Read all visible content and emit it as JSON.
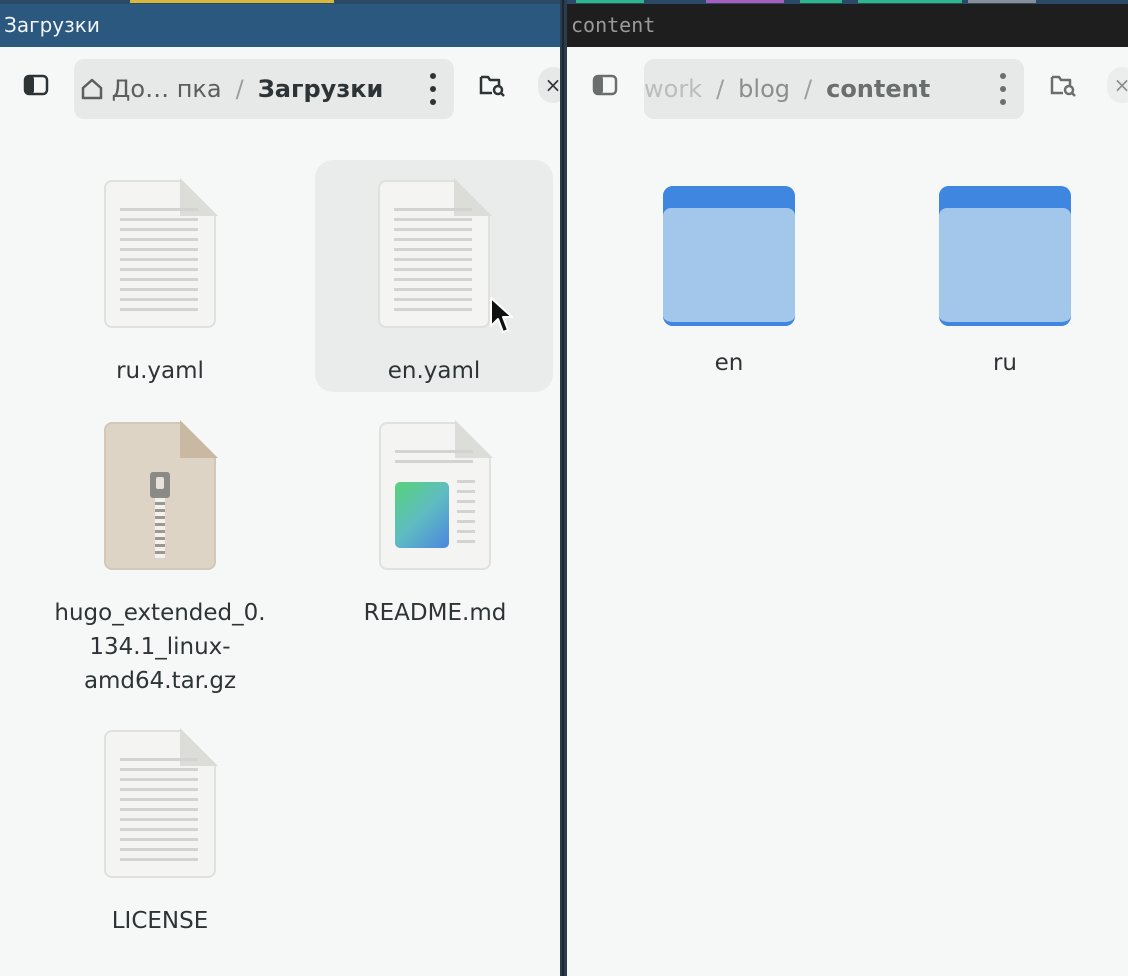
{
  "left_window": {
    "title": "Загрузки",
    "breadcrumb": {
      "home": "До… пка",
      "separator": "/",
      "current": "Загрузки"
    },
    "files": [
      {
        "name": "ru.yaml",
        "type": "text"
      },
      {
        "name": "en.yaml",
        "type": "text",
        "selected": true
      },
      {
        "name": "hugo_extended_0.134.1_linux-amd64.tar.gz",
        "type": "archive"
      },
      {
        "name": "README.md",
        "type": "markdown"
      },
      {
        "name": "LICENSE",
        "type": "text"
      }
    ]
  },
  "right_window": {
    "title": "content",
    "breadcrumb": {
      "seg1": "work",
      "seg2": "blog",
      "current": "content",
      "separator": "/"
    },
    "folders": [
      {
        "name": "en"
      },
      {
        "name": "ru"
      }
    ]
  },
  "icons": {
    "sidebar_toggle": "sidebar-toggle-icon",
    "home": "home-icon",
    "menu": "kebab-menu-icon",
    "search_folder": "folder-search-icon",
    "close": "close-icon"
  },
  "colors": {
    "left_titlebar": "#2b587e",
    "right_titlebar": "#1e1e1e",
    "folder_blue": "#3e86e0",
    "folder_light": "#a3c7ea",
    "selection": "#e9ecea"
  }
}
